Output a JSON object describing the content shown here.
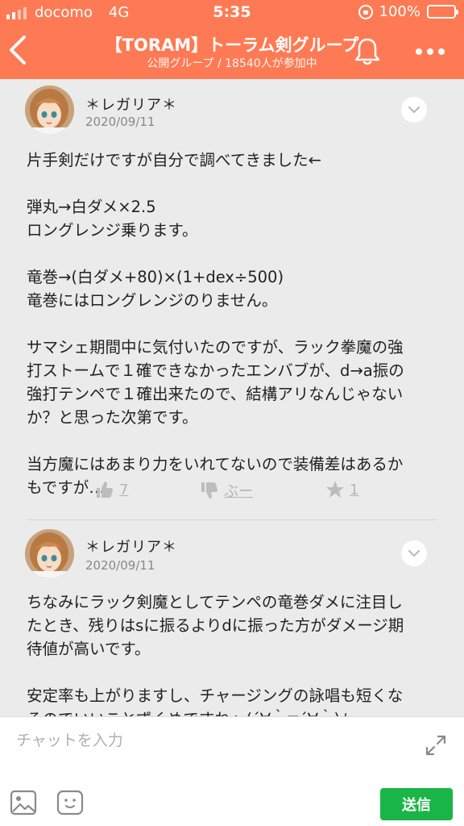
{
  "status_bar": {
    "carrier": "docomo",
    "network": "4G",
    "time": "5:35",
    "battery": "100%"
  },
  "header": {
    "title": "【TORAM】トーラム剣グループ",
    "subtitle": "公開グループ / 18540人が参加中"
  },
  "posts": [
    {
      "author": "＊レガリア＊",
      "date": "2020/09/11",
      "body": "片手剣だけですが自分で調べてきました←\n\n弾丸→白ダメ×2.5\nロングレンジ乗ります。\n\n竜巻→(白ダメ+80)×(1+dex÷500)\n竜巻にはロングレンジのりません。\n\nサマシェ期間中に気付いたのですが、ラック拳魔の強\n打ストームで１確できなかったエンバブが、d→a振の\n強打テンペで１確出来たので、結構アリなんじゃない\nか？と思った次第です。\n\n当方魔にはあまり力をいれてないので装備差はあるか\nもですが…",
      "likes": "7",
      "dislike_label": "ぶー",
      "stars": "1"
    },
    {
      "author": "＊レガリア＊",
      "date": "2020/09/11",
      "body": "ちなみにラック剣魔としてテンペの竜巻ダメに注目し\nたとき、残りはsに振るよりdに振った方がダメージ期\n待値が高いです。\n\n安定率も上がりますし、チャージングの詠唱も短くな\nるのでいいことずくめですねヽ(´∀｀≡´∀｀)ﾉ"
    }
  ],
  "composer": {
    "placeholder": "チャットを入力",
    "send_label": "送信"
  },
  "colors": {
    "header": "#fe7a54",
    "send": "#19b547",
    "background": "#ebebeb"
  }
}
